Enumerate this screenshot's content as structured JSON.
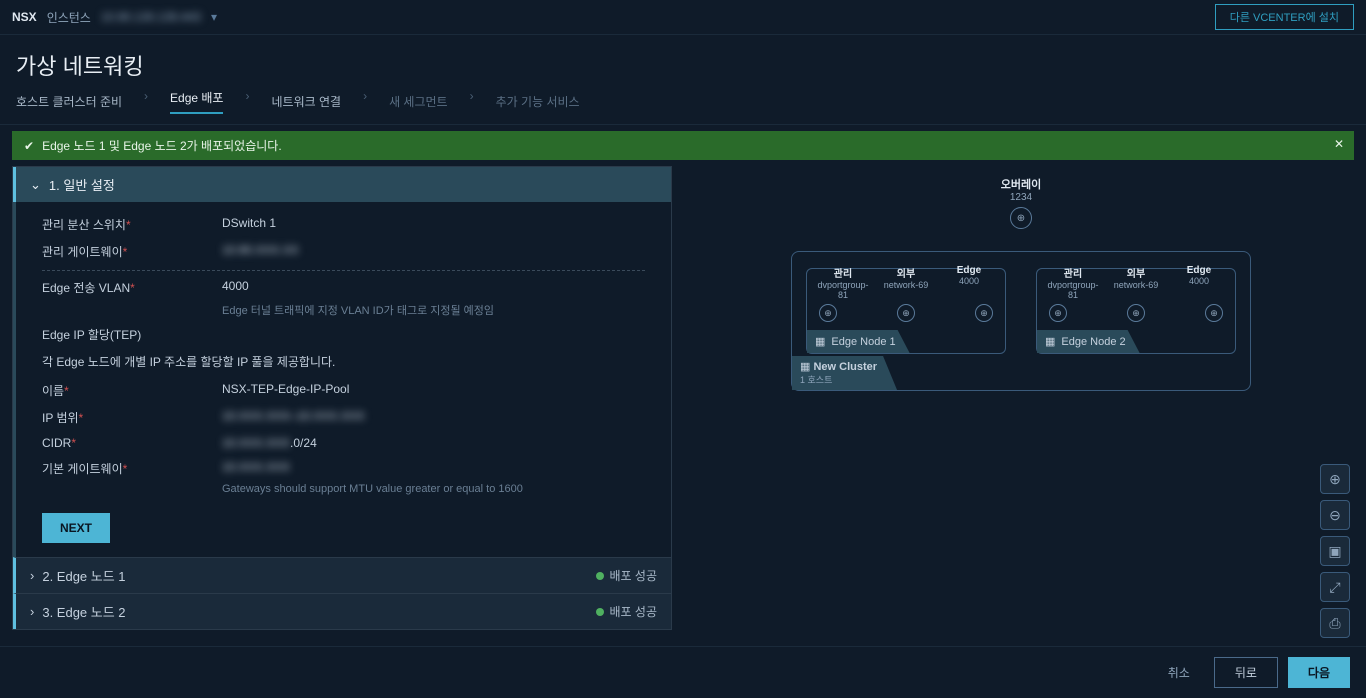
{
  "topbar": {
    "nsx": "NSX",
    "instance_label": "인스턴스",
    "instance_ip": "10.90.130.135:443",
    "install_btn": "다른 VCENTER에 설치"
  },
  "page_title": "가상 네트워킹",
  "breadcrumb": {
    "prep": "호스트 클러스터 준비",
    "edge_deploy": "Edge 배포",
    "net_connect": "네트워크 연결",
    "new_segment": "새 세그먼트",
    "extra_service": "추가 기능 서비스"
  },
  "alert": {
    "msg": "Edge 노드 1 및 Edge 노드 2가 배포되었습니다."
  },
  "form": {
    "section1_title": "1. 일반 설정",
    "mgmt_switch_label": "관리 분산 스위치",
    "mgmt_switch_value": "DSwitch 1",
    "mgmt_gateway_label": "관리 게이트웨이",
    "mgmt_gateway_value": "10.90.XXX.XX",
    "edge_vlan_label": "Edge 전송 VLAN",
    "edge_vlan_value": "4000",
    "edge_vlan_hint": "Edge 터널 트래픽에 지정 VLAN ID가 태그로 지정될 예정임",
    "edge_ip_title": "Edge IP 할당(TEP)",
    "edge_ip_desc": "각 Edge 노드에 개별 IP 주소를 할당할 IP 풀을 제공합니다.",
    "name_label": "이름",
    "name_value": "NSX-TEP-Edge-IP-Pool",
    "ip_range_label": "IP 범위",
    "ip_range_value": "10.XXX.XXX–10.XXX.XXX",
    "cidr_label": "CIDR",
    "cidr_value": "10.XXX.XXX.0/24",
    "gw_label": "기본 게이트웨이",
    "gw_value": "10.XXX.XXX",
    "gw_hint": "Gateways should support MTU value greater or equal to 1600",
    "next": "NEXT",
    "section2_title": "2. Edge 노드 1",
    "section3_title": "3. Edge 노드 2",
    "deploy_success": "배포 성공"
  },
  "topology": {
    "overlay_title": "오버레이",
    "overlay_sub": "1234",
    "col_mgmt": "관리",
    "col_mgmt_sub": "dvportgroup-81",
    "col_ext": "외부",
    "col_ext_sub": "network-69",
    "col_edge": "Edge",
    "col_edge_sub": "4000",
    "edge1": "Edge Node 1",
    "edge2": "Edge Node 2",
    "cluster_name": "New Cluster",
    "cluster_sub": "1 호스트"
  },
  "footer": {
    "cancel": "취소",
    "back": "뒤로",
    "next": "다음"
  }
}
